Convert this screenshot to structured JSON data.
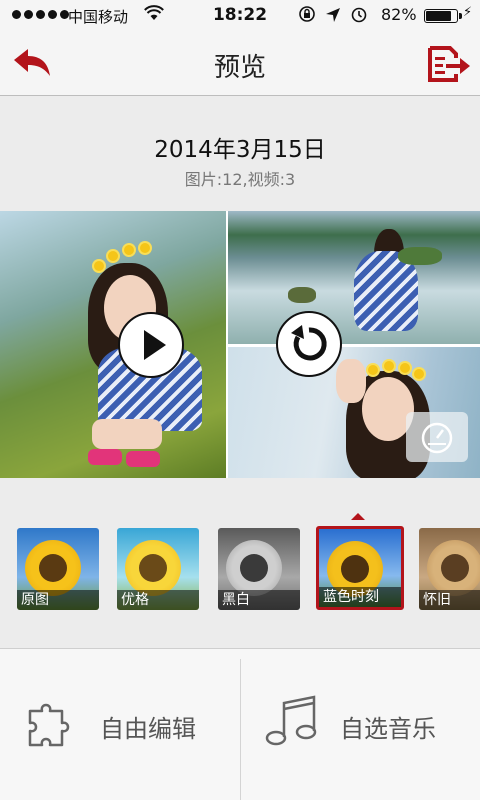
{
  "status_bar": {
    "carrier": "中国移动",
    "time": "18:22",
    "battery_percent": "82%",
    "battery_level": 0.82,
    "signal_bars": 5
  },
  "nav": {
    "title": "预览",
    "back_icon": "back-arrow-icon",
    "export_icon": "export-icon"
  },
  "album": {
    "date": "2014年3月15日",
    "counts": "图片:12,视频:3"
  },
  "collage": {
    "play_icon": "play-icon",
    "rotate_icon": "rotate-icon",
    "speed_icon": "speedometer-icon"
  },
  "filters": [
    {
      "label": "原图",
      "style": "original"
    },
    {
      "label": "优格",
      "style": "yoghurt"
    },
    {
      "label": "黑白",
      "style": "bw"
    },
    {
      "label": "蓝色时刻",
      "style": "blue",
      "selected": true
    },
    {
      "label": "怀旧",
      "style": "sepia"
    }
  ],
  "actions": {
    "edit_label": "自由编辑",
    "edit_icon": "puzzle-icon",
    "music_label": "自选音乐",
    "music_icon": "music-note-icon"
  },
  "colors": {
    "accent": "#b3141b",
    "background": "#ececec",
    "bar": "#f5f5f5"
  }
}
